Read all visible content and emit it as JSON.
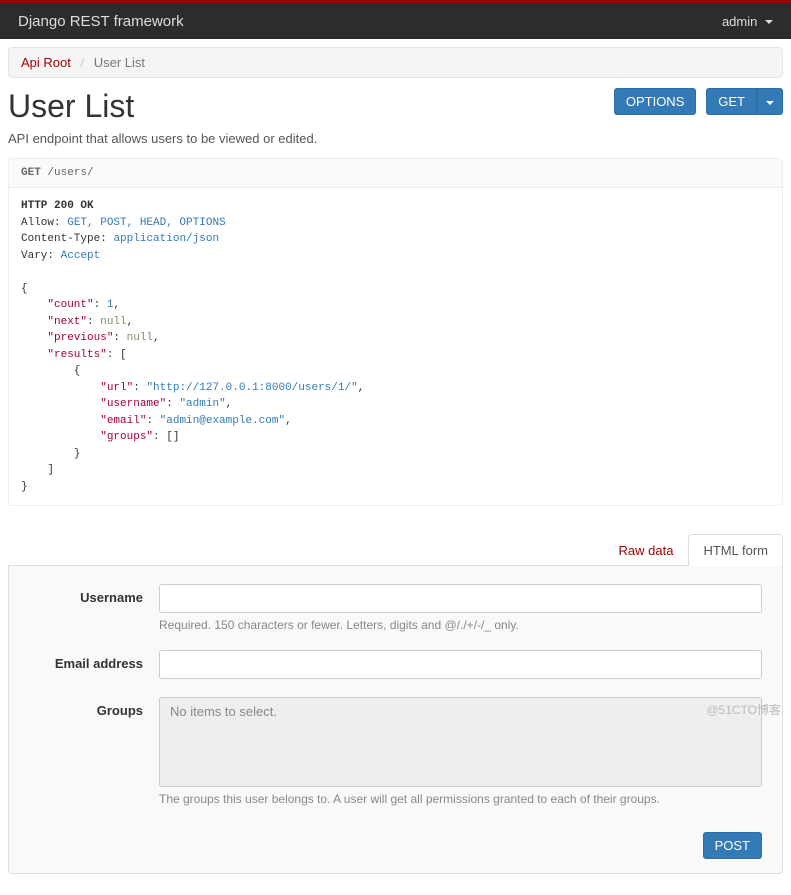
{
  "navbar": {
    "brand": "Django REST framework",
    "user": "admin"
  },
  "breadcrumb": {
    "root": "Api Root",
    "sep": "/",
    "current": "User List"
  },
  "page": {
    "title": "User List",
    "description": "API endpoint that allows users to be viewed or edited.",
    "options_btn": "OPTIONS",
    "get_btn": "GET"
  },
  "request": {
    "method": "GET",
    "path": "/users/"
  },
  "response": {
    "status_line": "HTTP 200 OK",
    "headers": {
      "allow_label": "Allow:",
      "allow_value": "GET, POST, HEAD, OPTIONS",
      "ct_label": "Content-Type:",
      "ct_value": "application/json",
      "vary_label": "Vary:",
      "vary_value": "Accept"
    },
    "body": {
      "count": 1,
      "next": "null",
      "previous": "null",
      "results": [
        {
          "url": "http://127.0.0.1:8000/users/1/",
          "username": "admin",
          "email": "admin@example.com",
          "groups": "[]"
        }
      ]
    }
  },
  "tabs": {
    "raw": "Raw data",
    "html": "HTML form"
  },
  "form": {
    "username_label": "Username",
    "username_help": "Required. 150 characters or fewer. Letters, digits and @/./+/-/_ only.",
    "email_label": "Email address",
    "groups_label": "Groups",
    "groups_placeholder": "No items to select.",
    "groups_help": "The groups this user belongs to. A user will get all permissions granted to each of their groups.",
    "post_btn": "POST"
  },
  "watermark": "@51CTO博客"
}
